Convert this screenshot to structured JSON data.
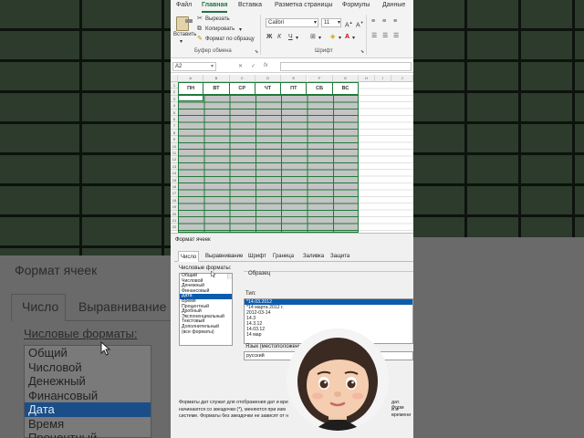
{
  "menu": {
    "items": [
      "Файл",
      "Главная",
      "Вставка",
      "Разметка страницы",
      "Формулы",
      "Данные"
    ],
    "active": "Главная"
  },
  "ribbon": {
    "paste_label": "Вставить",
    "cut_label": "Вырезать",
    "copy_label": "Копировать",
    "format_painter_label": "Формат по образцу",
    "clipboard_group": "Буфер обмена",
    "font_name": "Calibri",
    "font_size": "11",
    "font_group": "Шрифт",
    "bold": "Ж",
    "italic": "К",
    "underline": "Ч"
  },
  "formula_bar": {
    "name_box": "A2",
    "fx": "fx"
  },
  "sheet": {
    "columns": [
      "A",
      "B",
      "C",
      "D",
      "E",
      "F",
      "G",
      "H",
      "I",
      "J"
    ],
    "rows": [
      "1",
      "2",
      "3",
      "4",
      "5",
      "6",
      "7",
      "8",
      "9",
      "10",
      "11",
      "12",
      "13",
      "14",
      "15",
      "16",
      "17",
      "18",
      "19",
      "20",
      "21",
      "22"
    ],
    "days": [
      "ПН",
      "ВТ",
      "СР",
      "ЧТ",
      "ПТ",
      "СБ",
      "ВС"
    ]
  },
  "dialog": {
    "title": "Формат ячеек",
    "tabs": [
      "Число",
      "Выравнивание",
      "Шрифт",
      "Граница",
      "Заливка",
      "Защита"
    ],
    "active_tab": "Число",
    "categories_label": "Числовые форматы:",
    "categories": [
      "Общий",
      "Числовой",
      "Денежный",
      "Финансовый",
      "Дата",
      "Время",
      "Процентный",
      "Дробный",
      "Экспоненциальный",
      "Текстовый",
      "Дополнительный",
      "(все форматы)"
    ],
    "selected_category": "Дата",
    "sample_label": "Образец",
    "type_label": "Тип:",
    "types": [
      "*14.03.2012",
      "*14 марта 2012 г.",
      "2012-03-14",
      "14.3",
      "14.3.12",
      "14.03.12",
      "14 мар"
    ],
    "selected_type": "*14.03.2012",
    "language_label": "Язык (местоположение):",
    "language_value": "русский",
    "description_lines": [
      "Форматы дат служат для отображения дат и вре",
      "начинаются со звездочки (*), меняются при изм",
      "системе. Форматы без звездочки не зависят от н"
    ],
    "description_right": [
      "дат. Форм",
      "и и времени"
    ]
  },
  "background_zoom": {
    "title": "Формат ячеек",
    "tab_active": "Число",
    "tab_other": "Выравнивание",
    "categories_label": "Числовые форматы:",
    "categories": [
      "Общий",
      "Числовой",
      "Денежный",
      "Финансовый",
      "Дата",
      "Время",
      "Процентный"
    ],
    "selected_category": "Дата"
  }
}
